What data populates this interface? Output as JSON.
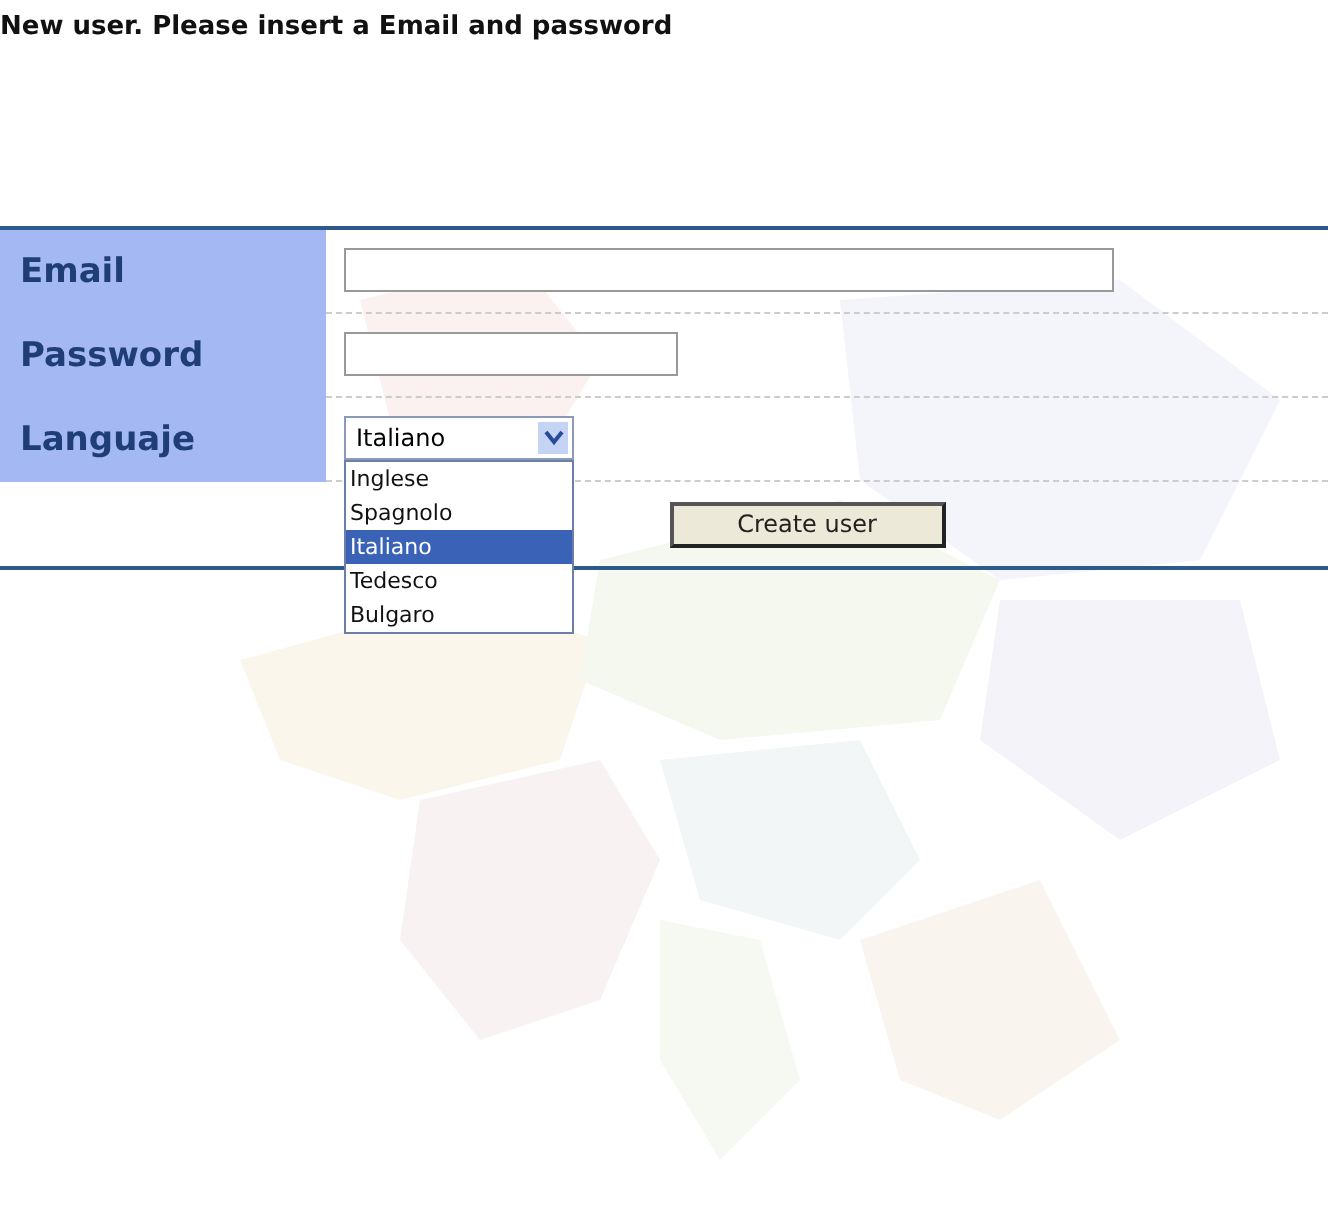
{
  "heading": "New user. Please insert a Email and password",
  "fields": [
    {
      "label": "Email",
      "kind": "text"
    },
    {
      "label": "Password",
      "kind": "password"
    },
    {
      "label": "Languaje",
      "kind": "select",
      "value": "Italiano",
      "expanded": true,
      "options": [
        {
          "label": "Inglese",
          "selected": false
        },
        {
          "label": "Spagnolo",
          "selected": false
        },
        {
          "label": "Italiano",
          "selected": true
        },
        {
          "label": "Tedesco",
          "selected": false
        },
        {
          "label": "Bulgaro",
          "selected": false
        }
      ]
    }
  ],
  "button": "Create user"
}
